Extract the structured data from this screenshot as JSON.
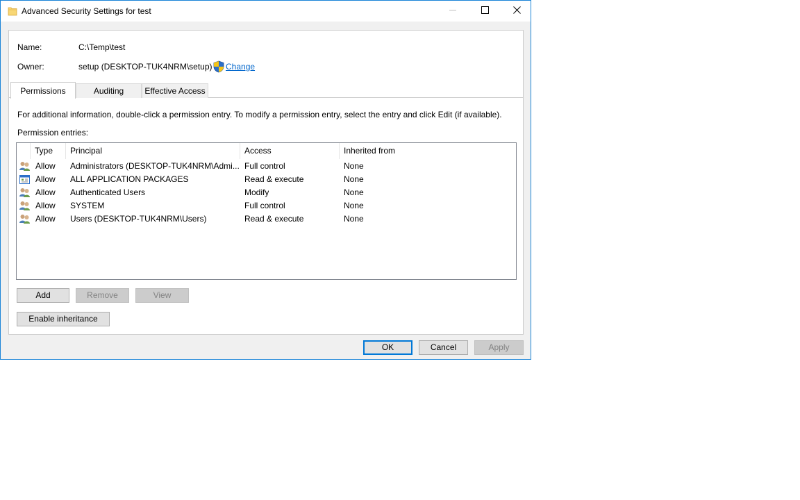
{
  "window": {
    "title": "Advanced Security Settings for test"
  },
  "info": {
    "name_label": "Name:",
    "name_value": "C:\\Temp\\test",
    "owner_label": "Owner:",
    "owner_value": "setup (DESKTOP-TUK4NRM\\setup)",
    "change_link": "Change"
  },
  "tabs": [
    {
      "label": "Permissions",
      "active": true
    },
    {
      "label": "Auditing",
      "active": false
    },
    {
      "label": "Effective Access",
      "active": false
    }
  ],
  "permissions": {
    "info_text": "For additional information, double-click a permission entry. To modify a permission entry, select the entry and click Edit (if available).",
    "entries_label": "Permission entries:",
    "columns": [
      "Type",
      "Principal",
      "Access",
      "Inherited from"
    ],
    "rows": [
      {
        "icon": "user-group-icon",
        "type": "Allow",
        "principal": "Administrators (DESKTOP-TUK4NRM\\Admi...",
        "access": "Full control",
        "inherited": "None"
      },
      {
        "icon": "app-packages-icon",
        "type": "Allow",
        "principal": "ALL APPLICATION PACKAGES",
        "access": "Read & execute",
        "inherited": "None"
      },
      {
        "icon": "user-group-icon",
        "type": "Allow",
        "principal": "Authenticated Users",
        "access": "Modify",
        "inherited": "None"
      },
      {
        "icon": "user-group-icon",
        "type": "Allow",
        "principal": "SYSTEM",
        "access": "Full control",
        "inherited": "None"
      },
      {
        "icon": "user-group-icon",
        "type": "Allow",
        "principal": "Users (DESKTOP-TUK4NRM\\Users)",
        "access": "Read & execute",
        "inherited": "None"
      }
    ],
    "add_button": "Add",
    "remove_button": "Remove",
    "view_button": "View",
    "inheritance_button": "Enable inheritance"
  },
  "footer": {
    "ok_button": "OK",
    "cancel_button": "Cancel",
    "apply_button": "Apply"
  },
  "colors": {
    "accent": "#0078d7",
    "link": "#0066cc",
    "window_border": "#1883d7"
  }
}
